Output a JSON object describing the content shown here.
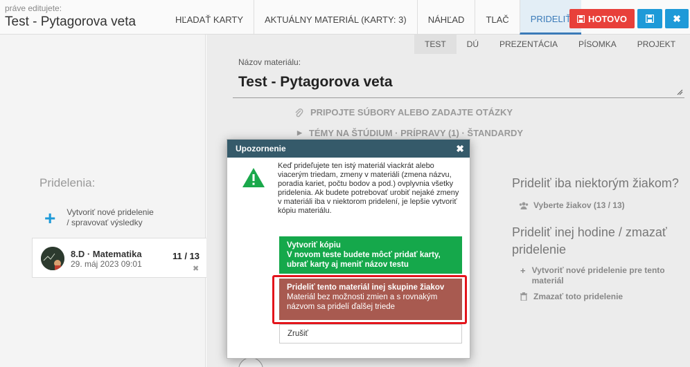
{
  "header": {
    "editing_label": "práve editujete:",
    "editing_title": "Test - Pytagorova veta",
    "nav": [
      {
        "label": "HĽADAŤ KARTY"
      },
      {
        "label": "AKTUÁLNY MATERIÁL (KARTY: 3)"
      },
      {
        "label": "NÁHĽAD"
      },
      {
        "label": "TLAČ"
      },
      {
        "label": "PRIDELIŤ"
      }
    ],
    "done_label": "HOTOVO"
  },
  "subtabs": [
    "TEST",
    "DÚ",
    "PREZENTÁCIA",
    "PÍSOMKA",
    "PROJEKT"
  ],
  "material": {
    "name_label": "Názov materiálu:",
    "name_value": "Test - Pytagorova veta",
    "attach_label": "PRIPOJTE SÚBORY ALEBO ZADAJTE OTÁZKY",
    "topics_label": "TÉMY NA ŠTÚDIUM · PRÍPRAVY (1) · ŠTANDARDY"
  },
  "left": {
    "title": "Pridelenia:",
    "new_assign_line1": "Vytvoriť nové pridelenie",
    "new_assign_line2": "/ spravovať výsledky",
    "card": {
      "class_name": "8.D · Matematika",
      "date": "29. máj 2023 09:01",
      "count": "11 / 13"
    }
  },
  "right": {
    "heading1": "Prideliť iba niektorým žiakom?",
    "select_students": "Vyberte žiakov (13 / 13)",
    "heading2": "Prideliť inej hodine / zmazať pridelenie",
    "new_for_material_line1": "Vytvoriť nové pridelenie pre tento",
    "new_for_material_line2": "materiál",
    "delete_assign": "Zmazať toto pridelenie"
  },
  "modal": {
    "title": "Upozornenie",
    "text": "Keď prideľujete ten istý materiál viackrát alebo viacerým triedam, zmeny v materiáli (zmena názvu, poradia kariet, počtu bodov a pod.) ovplyvnia všetky pridelenia. Ak budete potrebovať urobiť nejaké zmeny v materiáli iba v niektorom pridelení, je lepšie vytvoriť kópiu materiálu.",
    "copy_title": "Vytvoriť kópiu",
    "copy_desc": "V novom teste budete môcť pridať karty, ubrať karty aj meniť názov testu",
    "other_title": "Prideliť tento materiál inej skupine žiakov",
    "other_desc": "Materiál bez možnosti zmien a s rovnakým názvom sa pridelí ďalšej triede",
    "cancel": "Zrušiť"
  },
  "colors": {
    "accent": "#1e9ad8",
    "done": "#e8403a",
    "modal_header": "#355a6a",
    "copy_option": "#15a84b",
    "other_option": "#a85a50",
    "highlight": "#e3141b"
  }
}
